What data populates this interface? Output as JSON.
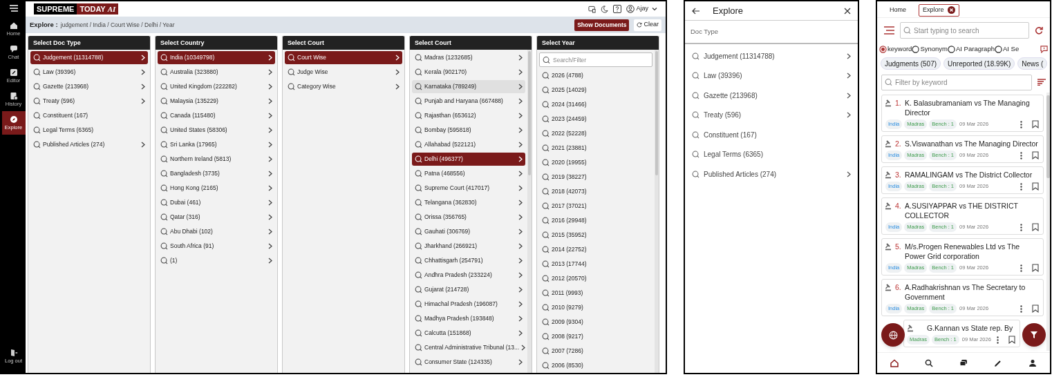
{
  "desktop": {
    "sidebar": {
      "items": [
        {
          "label": "Home",
          "selected": false
        },
        {
          "label": "Chat",
          "selected": false
        },
        {
          "label": "Editor",
          "selected": false
        },
        {
          "label": "History",
          "selected": false
        },
        {
          "label": "Explore",
          "selected": true
        }
      ],
      "logout": "Log out"
    },
    "header": {
      "logo": [
        "SUPREME",
        "TODAY",
        "AI"
      ],
      "user": "Ajay"
    },
    "breadcrumb": {
      "label": "Explore :",
      "path": "judgement / India / Court Wise / Delhi / Year"
    },
    "buttons": {
      "show": "Show Documents",
      "clear": "Clear"
    },
    "columns": [
      {
        "title": "Select Doc Type",
        "scrollbar": false,
        "items": [
          {
            "label": "Judgement (11314788)",
            "selected": true,
            "highlighted": false,
            "expandable": true
          },
          {
            "label": "Law (39396)",
            "selected": false,
            "highlighted": false,
            "expandable": true
          },
          {
            "label": "Gazette (213968)",
            "selected": false,
            "highlighted": false,
            "expandable": true
          },
          {
            "label": "Treaty (596)",
            "selected": false,
            "highlighted": false,
            "expandable": true
          },
          {
            "label": "Constituent (167)",
            "selected": false,
            "highlighted": false,
            "expandable": false
          },
          {
            "label": "Legal Terms (6365)",
            "selected": false,
            "highlighted": false,
            "expandable": false
          },
          {
            "label": "Published Articles (274)",
            "selected": false,
            "highlighted": false,
            "expandable": true
          }
        ]
      },
      {
        "title": "Select Country",
        "scrollbar": false,
        "items": [
          {
            "label": "India (10349798)",
            "selected": true,
            "highlighted": false,
            "expandable": true
          },
          {
            "label": "Australia (323880)",
            "selected": false,
            "highlighted": false,
            "expandable": true
          },
          {
            "label": "United Kingdom (222282)",
            "selected": false,
            "highlighted": false,
            "expandable": true
          },
          {
            "label": "Malaysia (135229)",
            "selected": false,
            "highlighted": false,
            "expandable": true
          },
          {
            "label": "Canada (115480)",
            "selected": false,
            "highlighted": false,
            "expandable": true
          },
          {
            "label": "United States (58306)",
            "selected": false,
            "highlighted": false,
            "expandable": true
          },
          {
            "label": "Sri Lanka (17965)",
            "selected": false,
            "highlighted": false,
            "expandable": true
          },
          {
            "label": "Northern Ireland (5813)",
            "selected": false,
            "highlighted": false,
            "expandable": true
          },
          {
            "label": "Bangladesh (3735)",
            "selected": false,
            "highlighted": false,
            "expandable": true
          },
          {
            "label": "Hong Kong (2165)",
            "selected": false,
            "highlighted": false,
            "expandable": true
          },
          {
            "label": "Dubai (461)",
            "selected": false,
            "highlighted": false,
            "expandable": true
          },
          {
            "label": "Qatar (316)",
            "selected": false,
            "highlighted": false,
            "expandable": true
          },
          {
            "label": "Abu Dhabi (102)",
            "selected": false,
            "highlighted": false,
            "expandable": true
          },
          {
            "label": "South Africa (91)",
            "selected": false,
            "highlighted": false,
            "expandable": true
          },
          {
            "label": " (1)",
            "selected": false,
            "highlighted": false,
            "expandable": true
          }
        ]
      },
      {
        "title": "Select Court",
        "scrollbar": false,
        "items": [
          {
            "label": "Court Wise",
            "selected": true,
            "highlighted": false,
            "expandable": true
          },
          {
            "label": "Judge Wise",
            "selected": false,
            "highlighted": false,
            "expandable": true
          },
          {
            "label": "Category Wise",
            "selected": false,
            "highlighted": false,
            "expandable": true
          }
        ]
      },
      {
        "title": "Select Court",
        "scrollbar": true,
        "items": [
          {
            "label": "Madras (1232685)",
            "selected": false,
            "highlighted": false,
            "expandable": true
          },
          {
            "label": "Kerala (902170)",
            "selected": false,
            "highlighted": false,
            "expandable": true
          },
          {
            "label": "Karnataka (789249)",
            "selected": false,
            "highlighted": true,
            "expandable": true
          },
          {
            "label": "Punjab and Haryana (667488)",
            "selected": false,
            "highlighted": false,
            "expandable": true
          },
          {
            "label": "Rajasthan (653612)",
            "selected": false,
            "highlighted": false,
            "expandable": true
          },
          {
            "label": "Bombay (595818)",
            "selected": false,
            "highlighted": false,
            "expandable": true
          },
          {
            "label": "Allahabad (522121)",
            "selected": false,
            "highlighted": false,
            "expandable": true
          },
          {
            "label": "Delhi (496377)",
            "selected": true,
            "highlighted": false,
            "expandable": true
          },
          {
            "label": "Patna (468556)",
            "selected": false,
            "highlighted": false,
            "expandable": true
          },
          {
            "label": "Supreme Court (417017)",
            "selected": false,
            "highlighted": false,
            "expandable": true
          },
          {
            "label": "Telangana (362830)",
            "selected": false,
            "highlighted": false,
            "expandable": true
          },
          {
            "label": "Orissa (356765)",
            "selected": false,
            "highlighted": false,
            "expandable": true
          },
          {
            "label": "Gauhati (306769)",
            "selected": false,
            "highlighted": false,
            "expandable": true
          },
          {
            "label": "Jharkhand (266921)",
            "selected": false,
            "highlighted": false,
            "expandable": true
          },
          {
            "label": "Chhattisgarh (254791)",
            "selected": false,
            "highlighted": false,
            "expandable": true
          },
          {
            "label": "Andhra Pradesh (233224)",
            "selected": false,
            "highlighted": false,
            "expandable": true
          },
          {
            "label": "Gujarat (214728)",
            "selected": false,
            "highlighted": false,
            "expandable": true
          },
          {
            "label": "Himachal Pradesh (196087)",
            "selected": false,
            "highlighted": false,
            "expandable": true
          },
          {
            "label": "Madhya Pradesh (193848)",
            "selected": false,
            "highlighted": false,
            "expandable": true
          },
          {
            "label": "Calcutta (151868)",
            "selected": false,
            "highlighted": false,
            "expandable": true
          },
          {
            "label": "Central Administrative Tribunal (13...",
            "selected": false,
            "highlighted": false,
            "expandable": true
          },
          {
            "label": "Consumer State (124335)",
            "selected": false,
            "highlighted": false,
            "expandable": true
          }
        ]
      },
      {
        "title": "Select Year",
        "scrollbar": true,
        "search": {
          "placeholder": "Search/Filter"
        },
        "items": [
          {
            "label": "2026 (4788)",
            "selected": false,
            "highlighted": false,
            "expandable": false
          },
          {
            "label": "2025 (14029)",
            "selected": false,
            "highlighted": false,
            "expandable": false
          },
          {
            "label": "2024 (31466)",
            "selected": false,
            "highlighted": false,
            "expandable": false
          },
          {
            "label": "2023 (24459)",
            "selected": false,
            "highlighted": false,
            "expandable": false
          },
          {
            "label": "2022 (52228)",
            "selected": false,
            "highlighted": false,
            "expandable": false
          },
          {
            "label": "2021 (23881)",
            "selected": false,
            "highlighted": false,
            "expandable": false
          },
          {
            "label": "2020 (19955)",
            "selected": false,
            "highlighted": false,
            "expandable": false
          },
          {
            "label": "2019 (38227)",
            "selected": false,
            "highlighted": false,
            "expandable": false
          },
          {
            "label": "2018 (42073)",
            "selected": false,
            "highlighted": false,
            "expandable": false
          },
          {
            "label": "2017 (37021)",
            "selected": false,
            "highlighted": false,
            "expandable": false
          },
          {
            "label": "2016 (29948)",
            "selected": false,
            "highlighted": false,
            "expandable": false
          },
          {
            "label": "2015 (35952)",
            "selected": false,
            "highlighted": false,
            "expandable": false
          },
          {
            "label": "2014 (22752)",
            "selected": false,
            "highlighted": false,
            "expandable": false
          },
          {
            "label": "2013 (17744)",
            "selected": false,
            "highlighted": false,
            "expandable": false
          },
          {
            "label": "2012 (20570)",
            "selected": false,
            "highlighted": false,
            "expandable": false
          },
          {
            "label": "2011 (9993)",
            "selected": false,
            "highlighted": false,
            "expandable": false
          },
          {
            "label": "2010 (9279)",
            "selected": false,
            "highlighted": false,
            "expandable": false
          },
          {
            "label": "2009 (9304)",
            "selected": false,
            "highlighted": false,
            "expandable": false
          },
          {
            "label": "2008 (9217)",
            "selected": false,
            "highlighted": false,
            "expandable": false
          },
          {
            "label": "2007 (7286)",
            "selected": false,
            "highlighted": false,
            "expandable": false
          },
          {
            "label": "2006 (8530)",
            "selected": false,
            "highlighted": false,
            "expandable": false
          }
        ]
      }
    ]
  },
  "mobile_explore": {
    "title": "Explore",
    "section": "Doc Type",
    "items": [
      {
        "label": "Judgement (11314788)",
        "expandable": true
      },
      {
        "label": "Law (39396)",
        "expandable": true
      },
      {
        "label": "Gazette (213968)",
        "expandable": true
      },
      {
        "label": "Treaty (596)",
        "expandable": true
      },
      {
        "label": "Constituent (167)",
        "expandable": false
      },
      {
        "label": "Legal Terms (6365)",
        "expandable": false
      },
      {
        "label": "Published Articles (274)",
        "expandable": true
      }
    ]
  },
  "mobile_search": {
    "tabs": [
      {
        "label": "Home",
        "selected": false,
        "closable": false
      },
      {
        "label": "Explore",
        "selected": true,
        "closable": true
      }
    ],
    "search": {
      "placeholder": "Start typing to search"
    },
    "modes": [
      {
        "label": "keyword",
        "selected": true
      },
      {
        "label": "Synonym",
        "selected": false
      },
      {
        "label": "AI Paragraph",
        "selected": false
      },
      {
        "label": "AI Se",
        "selected": false
      }
    ],
    "chips": [
      "Judgments (507)",
      "Unreported (18.99K)",
      "News ("
    ],
    "filter": {
      "placeholder": "Filter by keyword"
    },
    "results": [
      {
        "number": "1.",
        "title": "K. Balasubramaniam vs The Managing Director",
        "tags": [
          {
            "text": "India",
            "kind": "country"
          },
          {
            "text": "Madras",
            "kind": "court"
          },
          {
            "text": "Bench : 1",
            "kind": "bench"
          }
        ],
        "date": "09 Mar 2026"
      },
      {
        "number": "2.",
        "title": "S.Viswanathan vs The Managing Director",
        "tags": [
          {
            "text": "India",
            "kind": "country"
          },
          {
            "text": "Madras",
            "kind": "court"
          },
          {
            "text": "Bench : 1",
            "kind": "bench"
          }
        ],
        "date": "09 Mar 2026"
      },
      {
        "number": "3.",
        "title": "RAMALINGAM vs The District Collector",
        "tags": [
          {
            "text": "India",
            "kind": "country"
          },
          {
            "text": "Madras",
            "kind": "court"
          },
          {
            "text": "Bench : 1",
            "kind": "bench"
          }
        ],
        "date": "09 Mar 2026"
      },
      {
        "number": "4.",
        "title": "A.SUSIYAPPAR vs THE DISTRICT COLLECTOR",
        "tags": [
          {
            "text": "India",
            "kind": "country"
          },
          {
            "text": "Madras",
            "kind": "court"
          },
          {
            "text": "Bench : 1",
            "kind": "bench"
          }
        ],
        "date": "09 Mar 2026"
      },
      {
        "number": "5.",
        "title": "M/s.Progen Renewables Ltd vs The Power Grid corporation",
        "tags": [
          {
            "text": "India",
            "kind": "country"
          },
          {
            "text": "Madras",
            "kind": "court"
          },
          {
            "text": "Bench : 1",
            "kind": "bench"
          }
        ],
        "date": "09 Mar 2026"
      },
      {
        "number": "6.",
        "title": "A.Radhakrishnan vs The Secretary to Government",
        "tags": [
          {
            "text": "India",
            "kind": "country"
          },
          {
            "text": "Madras",
            "kind": "court"
          },
          {
            "text": "Bench : 1",
            "kind": "bench"
          }
        ],
        "date": "09 Mar 2026"
      },
      {
        "title": "G.Kannan vs State rep. By",
        "tags": [
          {
            "text": "Madras",
            "kind": "court"
          },
          {
            "text": "Bench : 1",
            "kind": "bench"
          }
        ],
        "date": "09 Mar 2026"
      }
    ],
    "nav": [
      {
        "selected": true
      },
      {
        "selected": false
      },
      {
        "selected": false
      },
      {
        "selected": false
      },
      {
        "selected": false
      }
    ]
  }
}
